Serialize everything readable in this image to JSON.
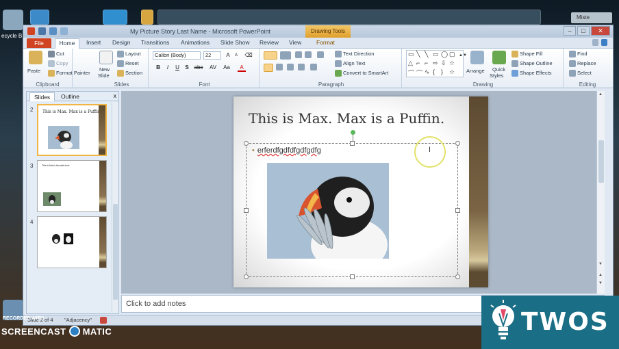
{
  "desktop": {
    "recycle_label": "ecycle B",
    "user_label": "Miste"
  },
  "window": {
    "title": "My Picture Story Last Name  -  Microsoft PowerPoint",
    "contextual_tab_group": "Drawing Tools",
    "buttons": {
      "minimize": "–",
      "maximize": "□",
      "close": "✕"
    }
  },
  "tabs": [
    "File",
    "Home",
    "Insert",
    "Design",
    "Transitions",
    "Animations",
    "Slide Show",
    "Review",
    "View",
    "Format"
  ],
  "ribbon": {
    "clipboard": {
      "label": "Clipboard",
      "paste": "Paste",
      "cut": "Cut",
      "copy": "Copy",
      "format_painter": "Format Painter"
    },
    "slides": {
      "label": "Slides",
      "new_slide": "New",
      "new_slide_2": "Slide",
      "layout": "Layout",
      "reset": "Reset",
      "section": "Section"
    },
    "font": {
      "label": "Font",
      "font_name": "Calibri (Body)",
      "font_size": "22",
      "bold": "B",
      "italic": "I",
      "underline": "U",
      "strike": "S",
      "abc": "abc",
      "spacing": "AV",
      "case": "Aa",
      "color": "A"
    },
    "paragraph": {
      "label": "Paragraph",
      "text_direction": "Text Direction",
      "align_text": "Align Text",
      "smartart": "Convert to SmartArt"
    },
    "drawing": {
      "label": "Drawing",
      "arrange": "Arrange",
      "quick_styles": "Quick",
      "quick_styles_2": "Styles",
      "shape_fill": "Shape Fill",
      "shape_outline": "Shape Outline",
      "shape_effects": "Shape Effects"
    },
    "editing": {
      "label": "Editing",
      "find": "Find",
      "replace": "Replace",
      "select": "Select"
    }
  },
  "left_pane": {
    "tabs": [
      "Slides",
      "Outline"
    ],
    "close": "x",
    "slides": [
      {
        "number": "2",
        "title": "This is Max. Max is a Puffin.",
        "selected": true
      },
      {
        "number": "3",
        "title": "This is Max's favorite food",
        "selected": false
      },
      {
        "number": "4",
        "title": "",
        "selected": false
      }
    ]
  },
  "slide": {
    "title": "This is Max. Max is a Puffin.",
    "bullet_text": "erferdfgdfdfgdfgdfg"
  },
  "notes": {
    "placeholder": "Click to add notes"
  },
  "status": {
    "slide_info": "Slide 2 of 4",
    "theme": "\"Adjacency\""
  },
  "overlays": {
    "recorded_with": "RECORDED WITH",
    "screencast_brand_left": "SCREENCAST",
    "screencast_brand_right": "MATIC",
    "watermark": "TWOS"
  },
  "colors": {
    "file_tab": "#d04424",
    "drawing_tools": "#e09f2c",
    "selection_cursor": "#e4e26a",
    "watermark_bg": "#1a6e86"
  }
}
